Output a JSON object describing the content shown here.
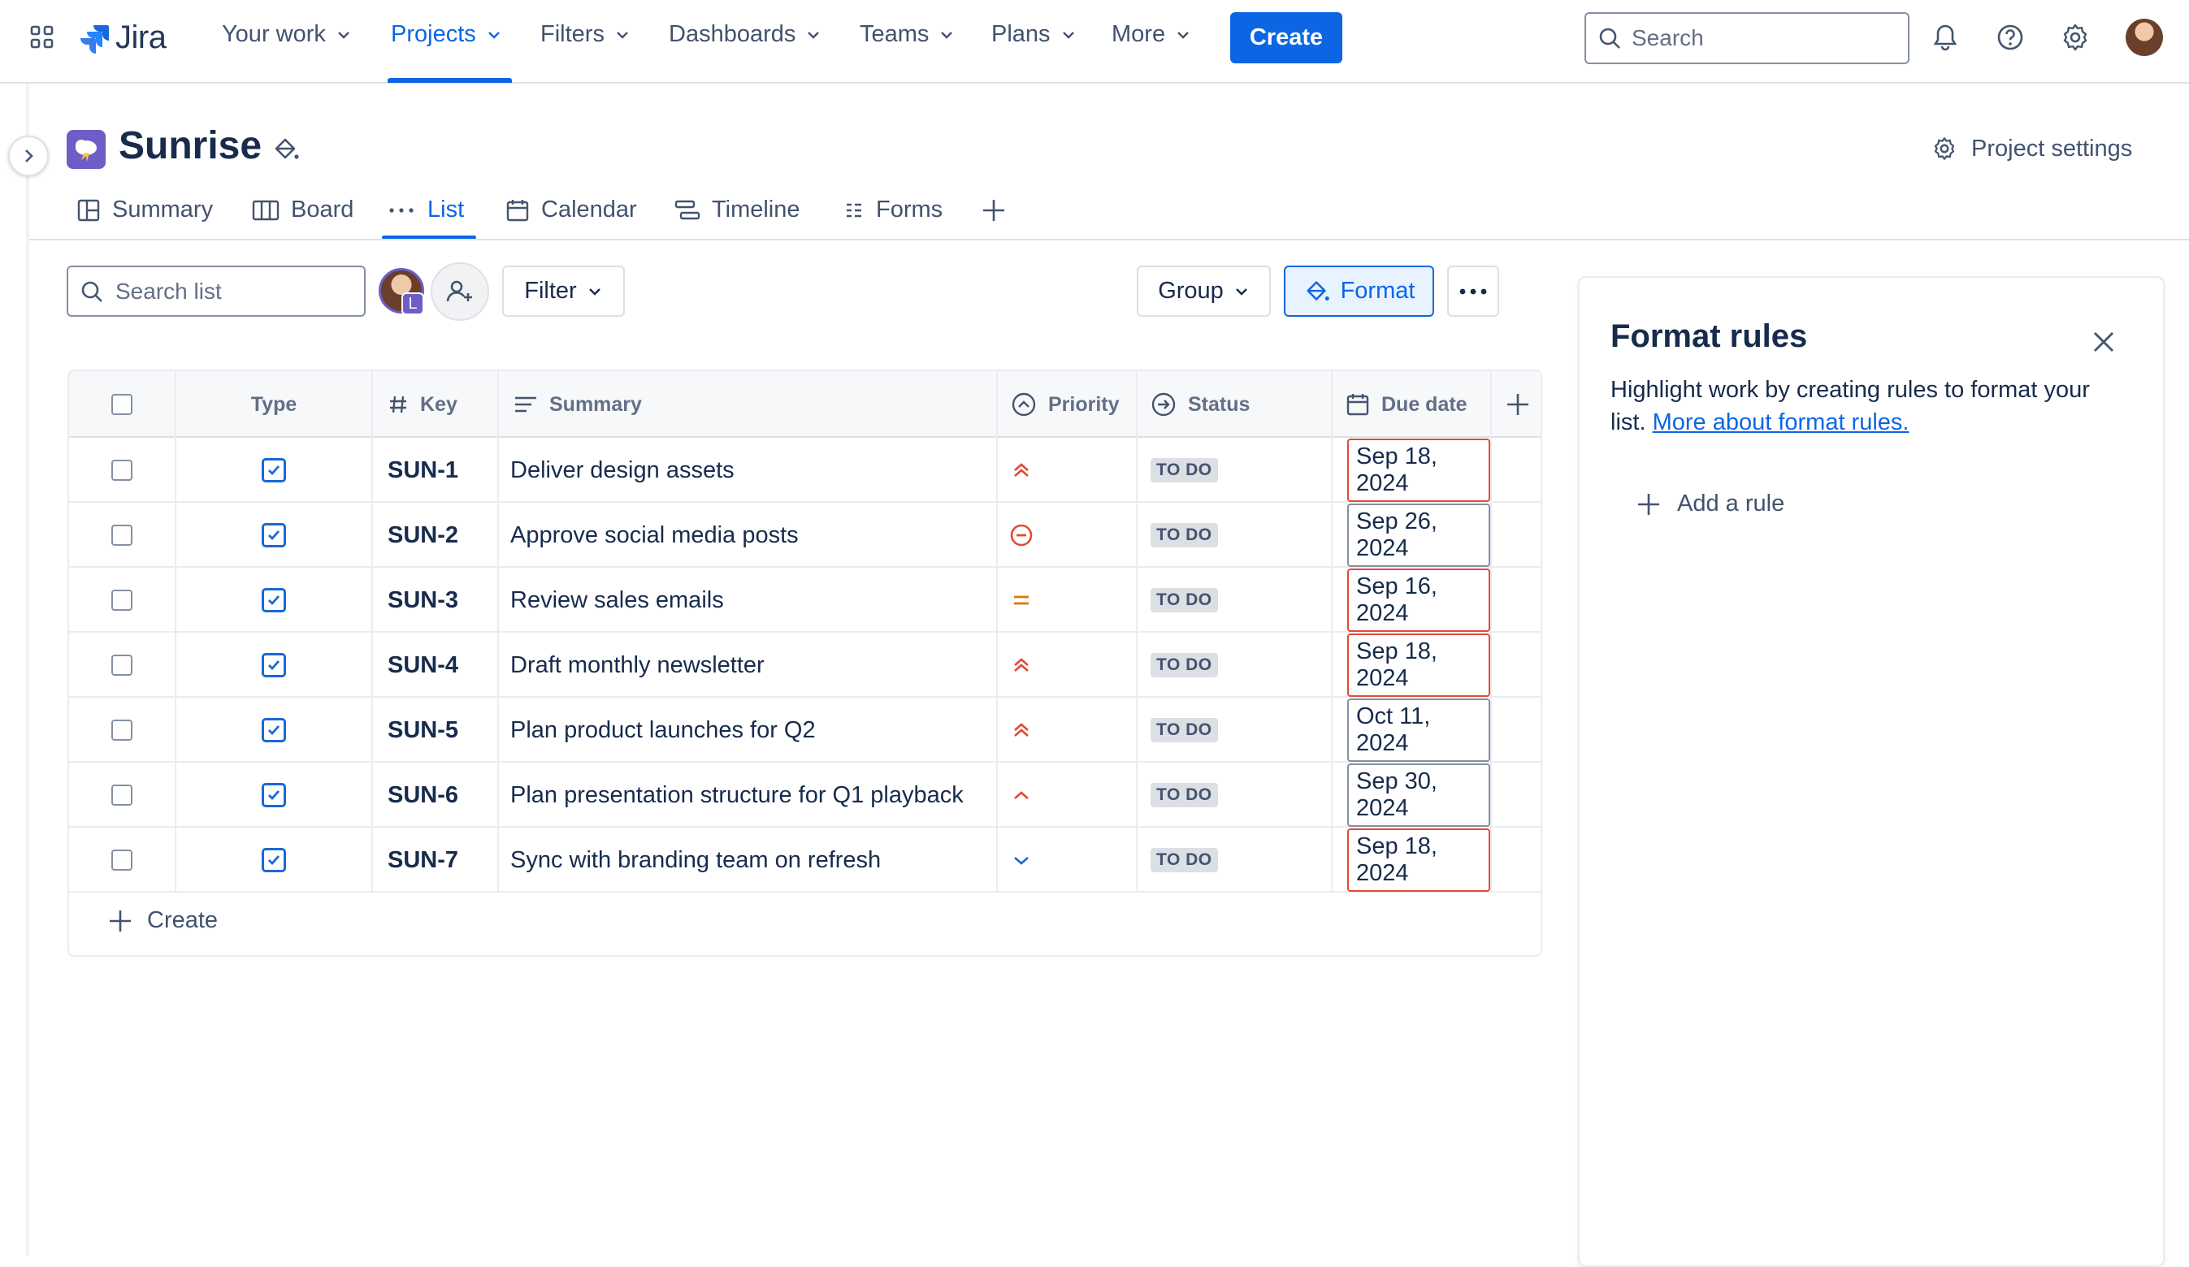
{
  "app": {
    "name": "Jira"
  },
  "nav": {
    "items": [
      {
        "label": "Your work",
        "active": false
      },
      {
        "label": "Projects",
        "active": true
      },
      {
        "label": "Filters",
        "active": false
      },
      {
        "label": "Dashboards",
        "active": false
      },
      {
        "label": "Teams",
        "active": false
      },
      {
        "label": "Plans",
        "active": false
      },
      {
        "label": "More",
        "active": false
      }
    ],
    "create_label": "Create",
    "search_placeholder": "Search"
  },
  "project": {
    "name": "Sunrise",
    "settings_label": "Project settings"
  },
  "tabs": [
    {
      "label": "Summary",
      "icon": "summary-icon",
      "active": false
    },
    {
      "label": "Board",
      "icon": "board-icon",
      "active": false
    },
    {
      "label": "List",
      "icon": "list-icon",
      "active": true
    },
    {
      "label": "Calendar",
      "icon": "calendar-icon",
      "active": false
    },
    {
      "label": "Timeline",
      "icon": "timeline-icon",
      "active": false
    },
    {
      "label": "Forms",
      "icon": "forms-icon",
      "active": false
    }
  ],
  "toolbar": {
    "search_placeholder": "Search list",
    "avatar_badge": "L",
    "filter_label": "Filter",
    "group_label": "Group",
    "format_label": "Format"
  },
  "table": {
    "columns": [
      "Type",
      "Key",
      "Summary",
      "Priority",
      "Status",
      "Due date"
    ],
    "rows": [
      {
        "key": "SUN-1",
        "summary": "Deliver design assets",
        "priority": "highest",
        "status": "TO DO",
        "due": "Sep 18, 2024",
        "overdue": true
      },
      {
        "key": "SUN-2",
        "summary": "Approve social media posts",
        "priority": "blocker",
        "status": "TO DO",
        "due": "Sep 26, 2024",
        "overdue": false
      },
      {
        "key": "SUN-3",
        "summary": "Review sales emails",
        "priority": "medium",
        "status": "TO DO",
        "due": "Sep 16, 2024",
        "overdue": true
      },
      {
        "key": "SUN-4",
        "summary": "Draft monthly newsletter",
        "priority": "highest",
        "status": "TO DO",
        "due": "Sep 18, 2024",
        "overdue": true
      },
      {
        "key": "SUN-5",
        "summary": "Plan product launches for Q2",
        "priority": "highest",
        "status": "TO DO",
        "due": "Oct 11, 2024",
        "overdue": false
      },
      {
        "key": "SUN-6",
        "summary": "Plan presentation structure for Q1 playback",
        "priority": "high",
        "status": "TO DO",
        "due": "Sep 30, 2024",
        "overdue": false
      },
      {
        "key": "SUN-7",
        "summary": "Sync with branding team on refresh",
        "priority": "low",
        "status": "TO DO",
        "due": "Sep 18, 2024",
        "overdue": true
      }
    ],
    "create_label": "Create"
  },
  "panel": {
    "title": "Format rules",
    "description": "Highlight work by creating rules to format your list.",
    "link_label": "More about format rules.",
    "add_rule_label": "Add a rule"
  },
  "colors": {
    "accent": "#0c66e4",
    "overdue_border": "#e34935",
    "priority_high": "#e34935",
    "priority_medium": "#e2740b",
    "priority_low": "#1868db"
  }
}
